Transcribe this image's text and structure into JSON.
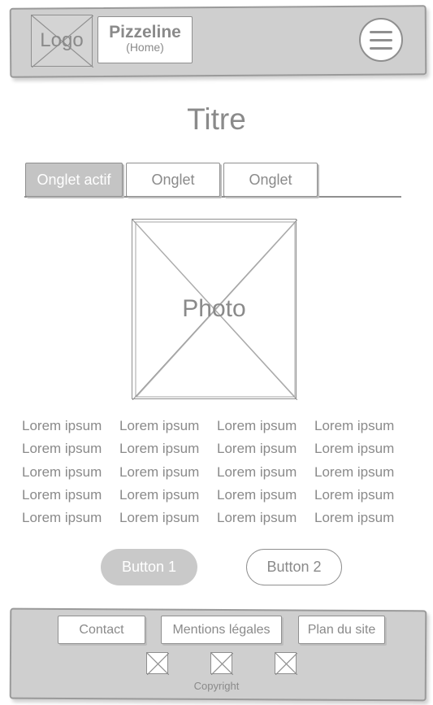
{
  "header": {
    "logo_label": "Logo",
    "brand_name": "Pizzeline",
    "brand_sub": "(Home)",
    "menu_icon": "hamburger-menu-icon"
  },
  "main": {
    "title": "Titre",
    "tabs": [
      {
        "label": "Onglet actif",
        "active": true
      },
      {
        "label": "Onglet",
        "active": false
      },
      {
        "label": "Onglet",
        "active": false
      }
    ],
    "photo_label": "Photo",
    "lorem_rows": [
      [
        "Lorem ipsum",
        "Lorem ipsum",
        "Lorem ipsum",
        "Lorem ipsum"
      ],
      [
        "Lorem ipsum",
        "Lorem ipsum",
        "Lorem ipsum",
        "Lorem ipsum"
      ],
      [
        "Lorem ipsum",
        "Lorem ipsum",
        "Lorem ipsum",
        "Lorem ipsum"
      ],
      [
        "Lorem ipsum",
        "Lorem ipsum",
        "Lorem ipsum",
        "Lorem ipsum"
      ],
      [
        "Lorem ipsum",
        "Lorem ipsum",
        "Lorem ipsum",
        "Lorem ipsum"
      ]
    ],
    "button_1": "Button 1",
    "button_2": "Button 2"
  },
  "footer": {
    "links": [
      "Contact",
      "Mentions légales",
      "Plan du site"
    ],
    "social_icons": [
      "placeholder-image-icon",
      "placeholder-image-icon",
      "placeholder-image-icon"
    ],
    "copyright": "Copyright"
  },
  "colors": {
    "bar_background": "#cfcfcf",
    "text_gray": "#8a8a8a",
    "active_tab": "#c4c4c4",
    "primary_button": "#c9c9c9"
  }
}
